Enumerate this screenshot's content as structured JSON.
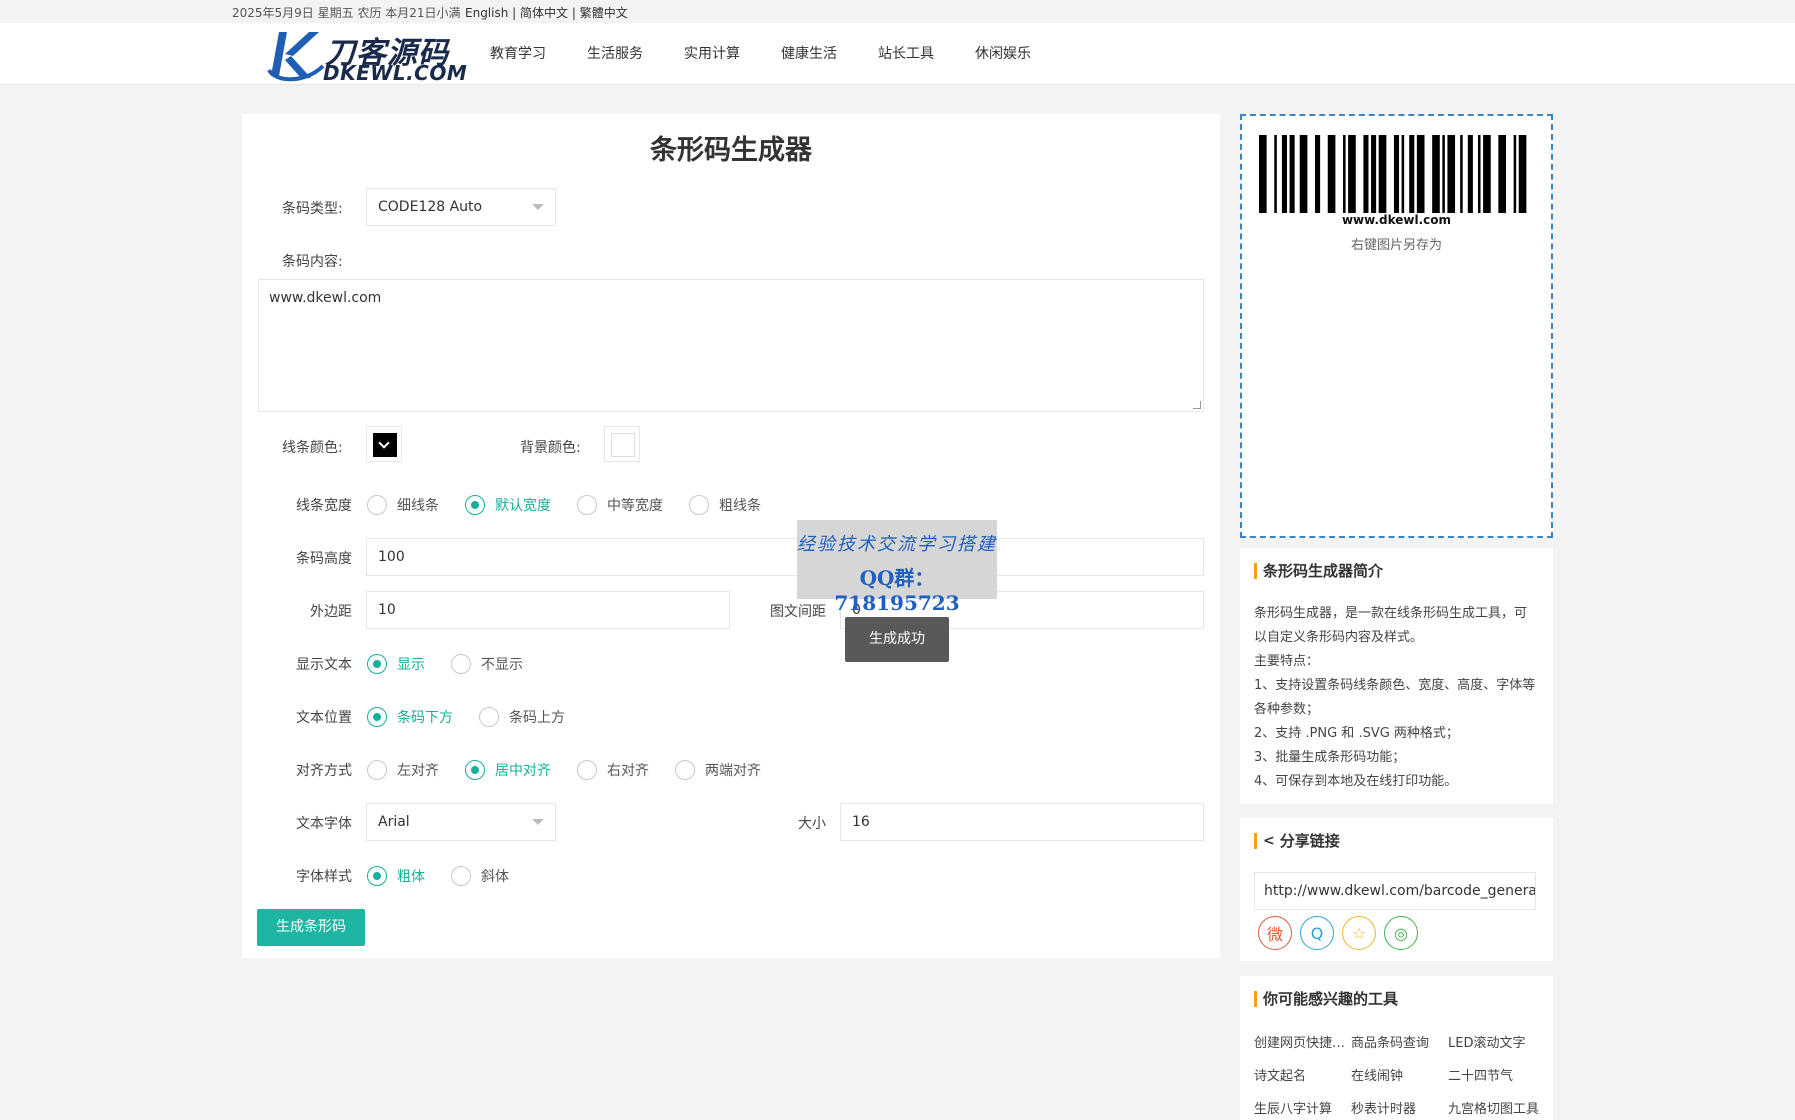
{
  "topbar": {
    "date": "2025年5月9日 星期五 农历 本月21日小满",
    "lang_en": "English",
    "lang_sep1": " | ",
    "lang_sc": "简体中文",
    "lang_sep2": " | ",
    "lang_tc": "繁體中文"
  },
  "logo": {
    "cn": "刀客源码",
    "en": "DKEWL.COM"
  },
  "nav": [
    "教育学习",
    "生活服务",
    "实用计算",
    "健康生活",
    "站长工具",
    "休闲娱乐"
  ],
  "form": {
    "title": "条形码生成器",
    "type_label": "条码类型:",
    "type_value": "CODE128 Auto",
    "content_label": "条码内容:",
    "content_value": "www.dkewl.com",
    "line_color_label": "线条颜色:",
    "line_color": "#000000",
    "bg_color_label": "背景颜色:",
    "bg_color": "#ffffff",
    "width_label": "线条宽度",
    "width_options": [
      "细线条",
      "默认宽度",
      "中等宽度",
      "粗线条"
    ],
    "width_selected": 1,
    "height_label": "条码高度",
    "height_value": "100",
    "margin_label": "外边距",
    "margin_value": "10",
    "text_gap_label": "图文间距",
    "text_gap_value": "0",
    "show_text_label": "显示文本",
    "show_text_options": [
      "显示",
      "不显示"
    ],
    "show_text_selected": 0,
    "text_pos_label": "文本位置",
    "text_pos_options": [
      "条码下方",
      "条码上方"
    ],
    "text_pos_selected": 0,
    "align_label": "对齐方式",
    "align_options": [
      "左对齐",
      "居中对齐",
      "右对齐",
      "两端对齐"
    ],
    "align_selected": 1,
    "font_label": "文本字体",
    "font_value": "Arial",
    "size_label": "大小",
    "size_value": "16",
    "style_label": "字体样式",
    "style_options": [
      "粗体",
      "斜体"
    ],
    "style_selected": 0,
    "generate_button": "生成条形码"
  },
  "toast": "生成成功",
  "watermark": {
    "line1": "经验技术交流学习搭建",
    "line2": "QQ群：718195723"
  },
  "preview": {
    "barcode_text": "www.dkewl.com",
    "save_hint": "右键图片另存为"
  },
  "intro": {
    "title": "条形码生成器简介",
    "lines": [
      "条形码生成器，是一款在线条形码生成工具，可以自定义条形码内容及样式。",
      "主要特点：",
      "1、支持设置条码线条颜色、宽度、高度、字体等各种参数；",
      "2、支持 .PNG 和 .SVG 两种格式；",
      "3、批量生成条形码功能；",
      "4、可保存到本地及在线打印功能。"
    ]
  },
  "share": {
    "title": "分享链接",
    "url": "http://www.dkewl.com/barcode_generator",
    "icons": [
      "weibo-icon",
      "qq-icon",
      "favorite-star-icon",
      "wechat-icon"
    ]
  },
  "tools": {
    "title": "你可能感兴趣的工具",
    "items": [
      "创建网页快捷方式",
      "商品条码查询",
      "LED滚动文字",
      "诗文起名",
      "在线闹钟",
      "二十四节气",
      "生辰八字计算",
      "秒表计时器",
      "九宫格切图工具"
    ]
  },
  "colors": {
    "accent": "#1fb5a3",
    "radio_on": "#16b09a",
    "preview_border": "#3a84c8",
    "section_bar": "#f2a01b"
  }
}
